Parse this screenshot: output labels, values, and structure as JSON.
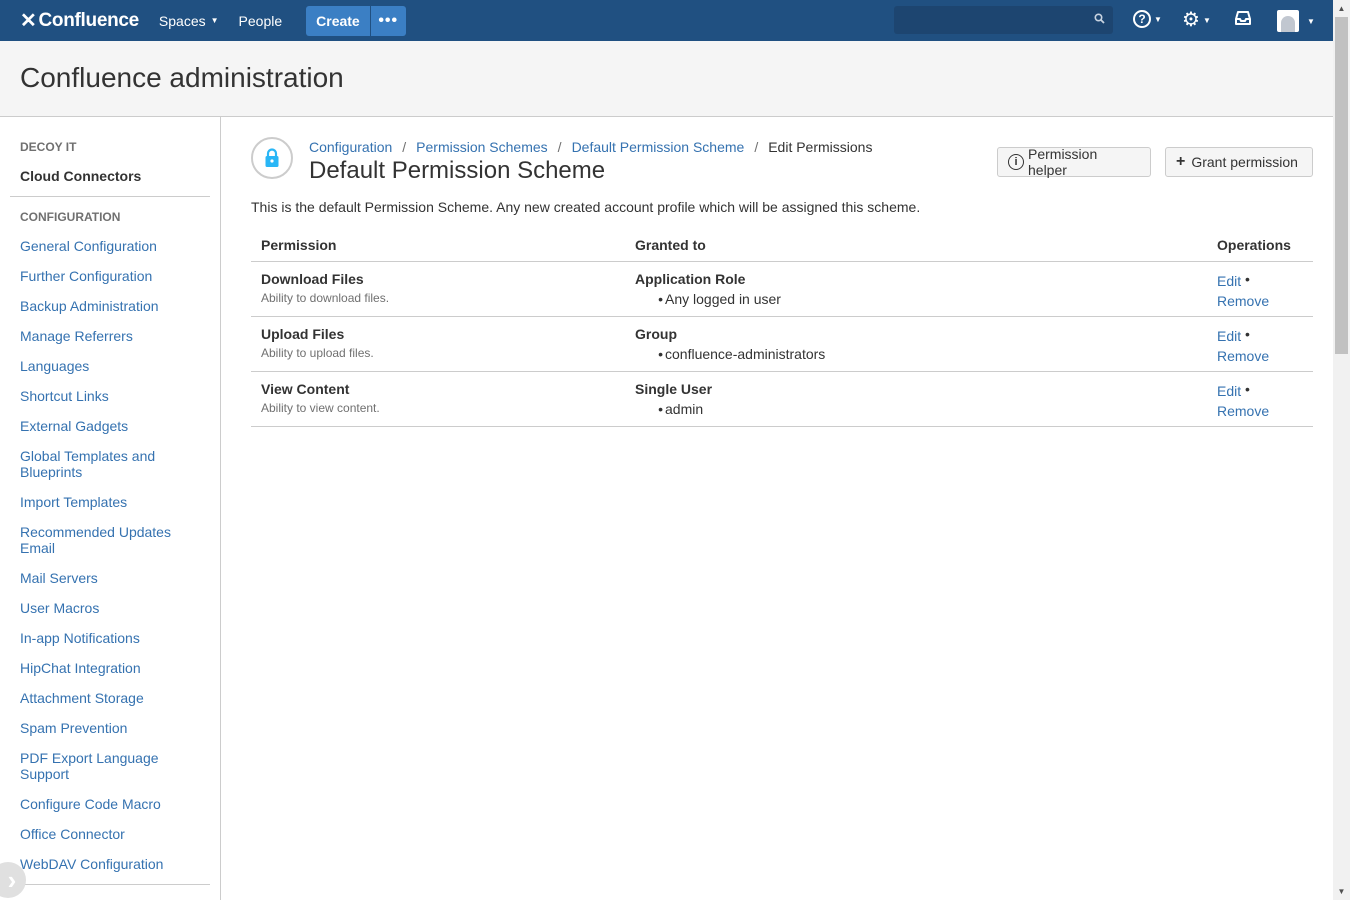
{
  "topnav": {
    "logo_text": "Confluence",
    "spaces_label": "Spaces",
    "people_label": "People",
    "create_label": "Create",
    "more_label": "•••"
  },
  "header": {
    "title": "Confluence administration"
  },
  "sidebar": {
    "section1_heading": "DECOY IT",
    "section1_item": "Cloud Connectors",
    "section2_heading": "CONFIGURATION",
    "items": [
      "General Configuration",
      "Further Configuration",
      "Backup Administration",
      "Manage Referrers",
      "Languages",
      "Shortcut Links",
      "External Gadgets",
      "Global Templates and Blueprints",
      "Import Templates",
      "Recommended Updates Email",
      "Mail Servers",
      "User Macros",
      "In-app Notifications",
      "HipChat Integration",
      "Attachment Storage",
      "Spam Prevention",
      "PDF Export Language Support",
      "Configure Code Macro",
      "Office Connector",
      "WebDAV Configuration"
    ]
  },
  "breadcrumb": {
    "items": [
      "Configuration",
      "Permission Schemes",
      "Default Permission Scheme"
    ],
    "current": "Edit Permissions",
    "separator": "/"
  },
  "page": {
    "title": "Default Permission Scheme",
    "description": "This is the default Permission Scheme. Any new created account profile which will be assigned this scheme.",
    "helper_button": "Permission helper",
    "grant_button": "Grant permission"
  },
  "table": {
    "headers": [
      "Permission",
      "Granted to",
      "Operations"
    ],
    "rows": [
      {
        "permission": "Download Files",
        "description": "Ability to download files.",
        "grant_type": "Application Role",
        "grant_value": "Any logged in user",
        "edit": "Edit",
        "remove": "Remove"
      },
      {
        "permission": "Upload Files",
        "description": "Ability to upload files.",
        "grant_type": "Group",
        "grant_value": "confluence-administrators",
        "edit": "Edit",
        "remove": "Remove"
      },
      {
        "permission": "View Content",
        "description": "Ability to view content.",
        "grant_type": "Single User",
        "grant_value": "admin",
        "edit": "Edit",
        "remove": "Remove"
      }
    ],
    "op_separator": "•"
  },
  "colors": {
    "nav_bg": "#205081",
    "link": "#3572b0",
    "lock": "#29b6f6"
  }
}
